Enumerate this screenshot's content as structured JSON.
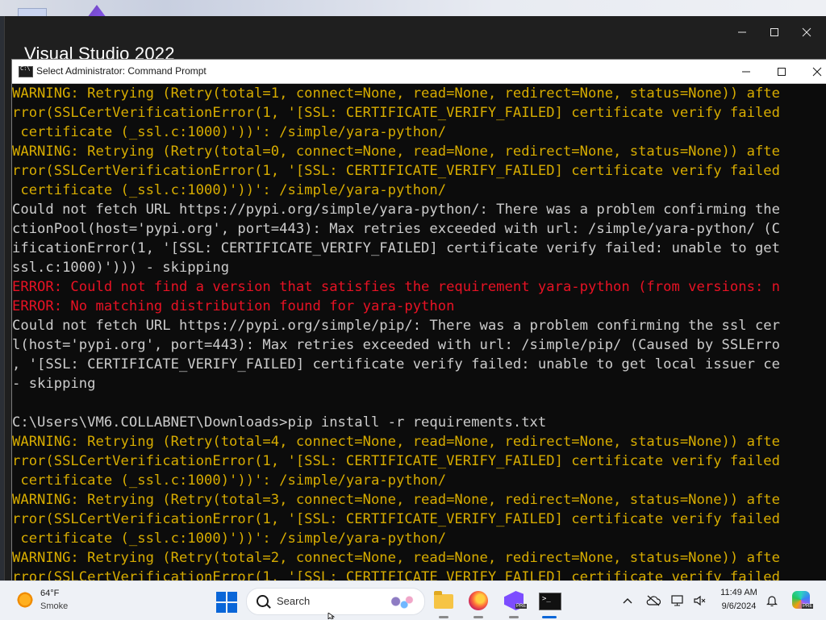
{
  "vs_window": {
    "title": "Visual Studio 2022"
  },
  "cmd_window": {
    "title": "Select Administrator: Command Prompt",
    "lines": [
      {
        "kind": "warn",
        "text": "WARNING: Retrying (Retry(total=1, connect=None, read=None, redirect=None, status=None)) afte"
      },
      {
        "kind": "warn",
        "text": "rror(SSLCertVerificationError(1, '[SSL: CERTIFICATE_VERIFY_FAILED] certificate verify failed"
      },
      {
        "kind": "warn",
        "text": " certificate (_ssl.c:1000)'))': /simple/yara-python/"
      },
      {
        "kind": "warn",
        "text": "WARNING: Retrying (Retry(total=0, connect=None, read=None, redirect=None, status=None)) afte"
      },
      {
        "kind": "warn",
        "text": "rror(SSLCertVerificationError(1, '[SSL: CERTIFICATE_VERIFY_FAILED] certificate verify failed"
      },
      {
        "kind": "warn",
        "text": " certificate (_ssl.c:1000)'))': /simple/yara-python/"
      },
      {
        "kind": "normal",
        "text": "Could not fetch URL https://pypi.org/simple/yara-python/: There was a problem confirming the"
      },
      {
        "kind": "normal",
        "text": "ctionPool(host='pypi.org', port=443): Max retries exceeded with url: /simple/yara-python/ (C"
      },
      {
        "kind": "normal",
        "text": "ificationError(1, '[SSL: CERTIFICATE_VERIFY_FAILED] certificate verify failed: unable to get"
      },
      {
        "kind": "normal",
        "text": "ssl.c:1000)'))) - skipping"
      },
      {
        "kind": "err",
        "text": "ERROR: Could not find a version that satisfies the requirement yara-python (from versions: n"
      },
      {
        "kind": "err",
        "text": "ERROR: No matching distribution found for yara-python"
      },
      {
        "kind": "normal",
        "text": "Could not fetch URL https://pypi.org/simple/pip/: There was a problem confirming the ssl cer"
      },
      {
        "kind": "normal",
        "text": "l(host='pypi.org', port=443): Max retries exceeded with url: /simple/pip/ (Caused by SSLErro"
      },
      {
        "kind": "normal",
        "text": ", '[SSL: CERTIFICATE_VERIFY_FAILED] certificate verify failed: unable to get local issuer ce"
      },
      {
        "kind": "normal",
        "text": "- skipping"
      },
      {
        "kind": "normal",
        "text": ""
      },
      {
        "kind": "normal",
        "text": "C:\\Users\\VM6.COLLABNET\\Downloads>pip install -r requirements.txt"
      },
      {
        "kind": "warn",
        "text": "WARNING: Retrying (Retry(total=4, connect=None, read=None, redirect=None, status=None)) afte"
      },
      {
        "kind": "warn",
        "text": "rror(SSLCertVerificationError(1, '[SSL: CERTIFICATE_VERIFY_FAILED] certificate verify failed"
      },
      {
        "kind": "warn",
        "text": " certificate (_ssl.c:1000)'))': /simple/yara-python/"
      },
      {
        "kind": "warn",
        "text": "WARNING: Retrying (Retry(total=3, connect=None, read=None, redirect=None, status=None)) afte"
      },
      {
        "kind": "warn",
        "text": "rror(SSLCertVerificationError(1, '[SSL: CERTIFICATE_VERIFY_FAILED] certificate verify failed"
      },
      {
        "kind": "warn",
        "text": " certificate (_ssl.c:1000)'))': /simple/yara-python/"
      },
      {
        "kind": "warn",
        "text": "WARNING: Retrying (Retry(total=2, connect=None, read=None, redirect=None, status=None)) afte"
      },
      {
        "kind": "warn",
        "text": "rror(SSLCertVerificationError(1, '[SSL: CERTIFICATE_VERIFY_FAILED] certificate verify failed"
      }
    ]
  },
  "taskbar": {
    "weather": {
      "temp": "64°F",
      "condition": "Smoke"
    },
    "search_placeholder": "Search",
    "apps": [
      "file-explorer-icon",
      "firefox-icon",
      "visual-studio-preview-icon",
      "terminal-icon"
    ],
    "vs_badge": "PRE",
    "copilot_badge": "PRE",
    "clock": {
      "time": "11:49 AM",
      "date": "9/6/2024"
    }
  },
  "colors": {
    "warning": "#d7ac00",
    "error": "#e81224",
    "console_text": "#cccccc",
    "console_bg": "#0c0c0c",
    "accent": "#0a66d8"
  }
}
